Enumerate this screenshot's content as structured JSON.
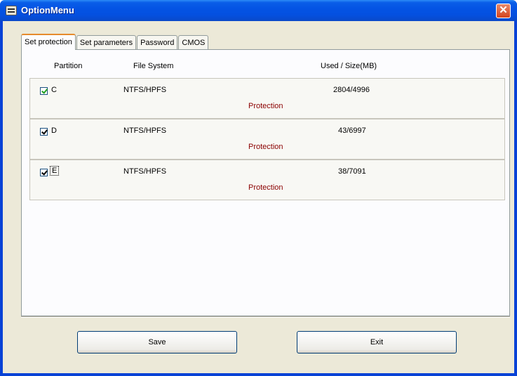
{
  "window": {
    "title": "OptionMenu",
    "close_label": "✕"
  },
  "tabs": [
    {
      "label": "Set protection",
      "active": true
    },
    {
      "label": "Set parameters",
      "active": false
    },
    {
      "label": "Password",
      "active": false
    },
    {
      "label": "CMOS",
      "active": false
    }
  ],
  "columns": {
    "partition": "Partition",
    "file_system": "File System",
    "used_size": "Used / Size(MB)"
  },
  "partitions": [
    {
      "letter": "C",
      "file_system": "NTFS/HPFS",
      "used_size": "2804/4996",
      "status": "Protection",
      "checked": true
    },
    {
      "letter": "D",
      "file_system": "NTFS/HPFS",
      "used_size": "43/6997",
      "status": "Protection",
      "checked": true
    },
    {
      "letter": "E",
      "file_system": "NTFS/HPFS",
      "used_size": "38/7091",
      "status": "Protection",
      "checked": true
    }
  ],
  "buttons": {
    "save": "Save",
    "exit": "Exit"
  },
  "colors": {
    "title_bar": "#0454e4",
    "status_text": "#8b0000",
    "panel_bg": "#ece9d8"
  }
}
